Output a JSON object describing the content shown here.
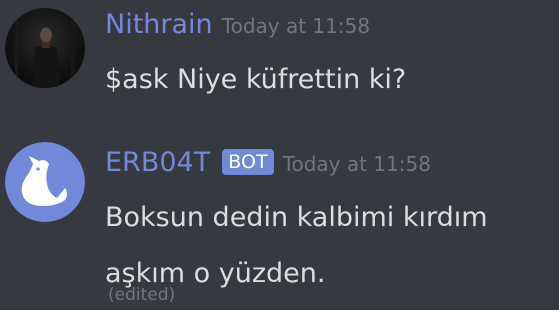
{
  "messages": [
    {
      "username": "Nithrain",
      "timestamp": "Today at 11:58",
      "text": "$ask Niye küfrettin ki?",
      "avatar_icon": "dark-figure-avatar"
    },
    {
      "username": "ERB04T",
      "bot_tag": "BOT",
      "timestamp": "Today at 11:58",
      "text_line1": "Boksun dedin kalbimi kırdım",
      "text_line2": "aşkım o yüzden.",
      "edited": "(edited)",
      "avatar_icon": "white-wolf-avatar"
    }
  ],
  "colors": {
    "background": "#36393f",
    "username": "#7289da",
    "bot_tag_bg": "#7289da",
    "text": "#dcddde",
    "muted": "#72767d"
  }
}
